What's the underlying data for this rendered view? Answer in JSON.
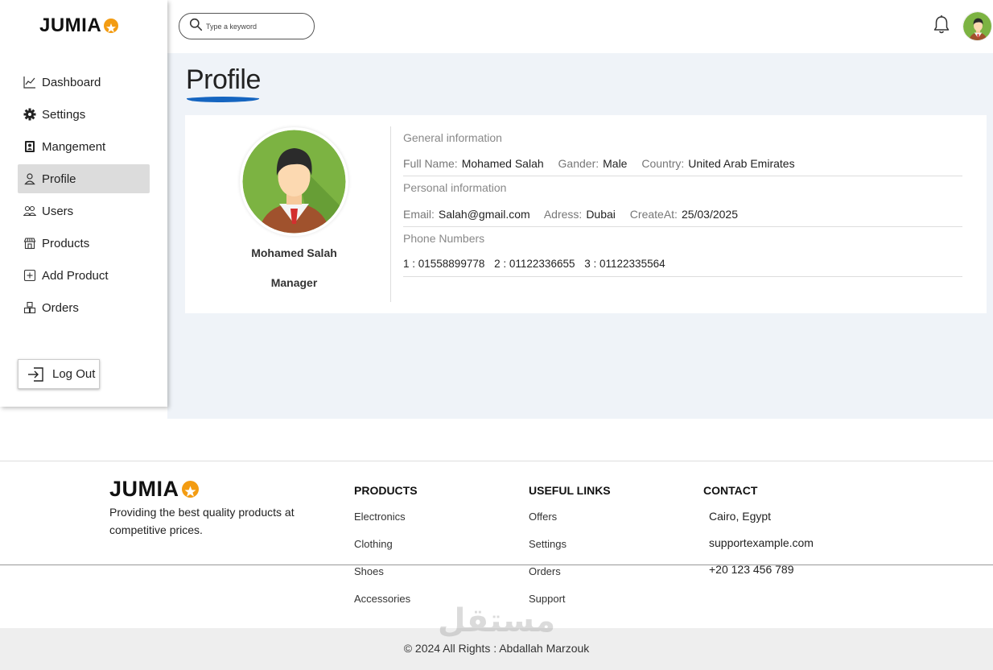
{
  "brand": {
    "logo_text": "JUMIA",
    "accent": "#f39c12"
  },
  "header": {
    "search_placeholder": "Type a keyword"
  },
  "sidebar": {
    "items": [
      {
        "label": "Dashboard",
        "icon": "chart-line-icon"
      },
      {
        "label": "Settings",
        "icon": "gear-icon"
      },
      {
        "label": "Mangement",
        "icon": "id-badge-icon"
      },
      {
        "label": "Profile",
        "icon": "user-icon",
        "active": true
      },
      {
        "label": "Users",
        "icon": "users-icon"
      },
      {
        "label": "Products",
        "icon": "store-icon"
      },
      {
        "label": "Add Product",
        "icon": "plus-square-icon"
      },
      {
        "label": "Orders",
        "icon": "boxes-icon"
      }
    ],
    "logout_label": "Log Out"
  },
  "page": {
    "title": "Profile",
    "underline_color": "#1565c0"
  },
  "profile": {
    "name": "Mohamed Salah",
    "role": "Manager",
    "general": {
      "heading": "General information",
      "full_name_key": "Full Name:",
      "full_name": "Mohamed Salah",
      "gender_key": "Gander:",
      "gender": "Male",
      "country_key": "Country:",
      "country": "United Arab Emirates"
    },
    "personal": {
      "heading": "Personal information",
      "email_key": "Email:",
      "email": "Salah@gmail.com",
      "address_key": "Adress:",
      "address": "Dubai",
      "created_key": "CreateAt:",
      "created": "25/03/2025"
    },
    "phones": {
      "heading": "Phone Numbers",
      "list": [
        "1 : 01558899778",
        "2 : 01122336655",
        "3 : 01122335564"
      ]
    }
  },
  "footer": {
    "logo_text": "JUMIA",
    "description": "Providing the best quality products at competitive prices.",
    "products": {
      "heading": "PRODUCTS",
      "links": [
        "Electronics",
        "Clothing",
        "Shoes",
        "Accessories"
      ]
    },
    "useful": {
      "heading": "USEFUL LINKS",
      "links": [
        "Offers",
        "Settings",
        "Orders",
        "Support"
      ]
    },
    "contact": {
      "heading": "CONTACT",
      "lines": [
        "Cairo, Egypt",
        "supportexample.com",
        "+20 123 456 789"
      ]
    },
    "copyright": "© 2024 All Rights : Abdallah Marzouk",
    "watermark": "مستقل"
  }
}
